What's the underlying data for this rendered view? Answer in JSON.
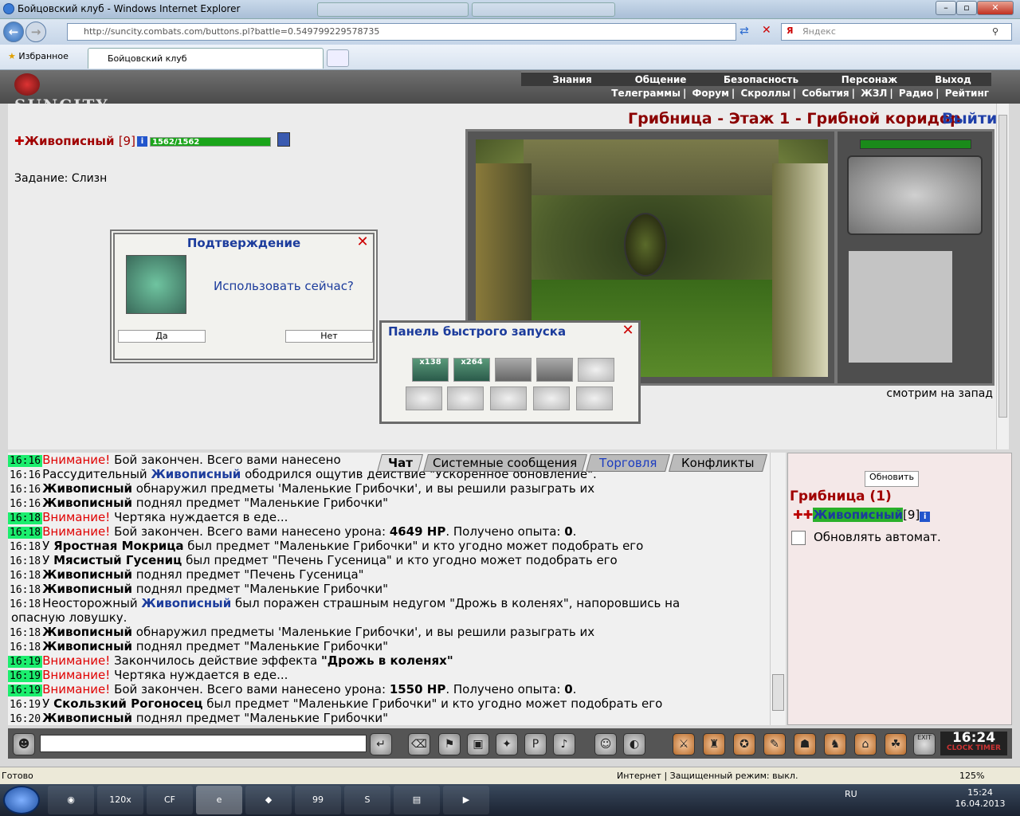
{
  "window": {
    "title": "Бойцовский клуб - Windows Internet Explorer"
  },
  "address": {
    "url": "http://suncity.combats.com/buttons.pl?battle=0.549799229578735",
    "search_placeholder": "Яндекс"
  },
  "favorites": {
    "label": "Избранное",
    "tab_label": "Бойцовский клуб"
  },
  "site": {
    "logo": "SUNCITY",
    "menu_main": [
      "Знания",
      "Общение",
      "Безопасность",
      "Персонаж",
      "Выход"
    ],
    "menu_sub": [
      "Телеграммы",
      "Форум",
      "Скроллы",
      "События",
      "ЖЗЛ",
      "Радио",
      "Рейтинг"
    ]
  },
  "player": {
    "name": "Живописный",
    "level": "[9]",
    "hp": "1562/1562",
    "info_icon": "i"
  },
  "task": "Задание: Слизн",
  "location": {
    "title": "Грибница - Этаж 1 - Грибной коридор",
    "exit": "Выйти",
    "direction": "смотрим на запад"
  },
  "confirm": {
    "title": "Подтверждение",
    "question": "Использовать сейчас?",
    "yes": "Да",
    "no": "Нет"
  },
  "quick_panel": {
    "title": "Панель быстрого запуска",
    "slot1": "x138",
    "slot2": "x264"
  },
  "chat_tabs": [
    "Чат",
    "Системные сообщения",
    "Торговля",
    "Конфликты"
  ],
  "chat": [
    {
      "time": "16:16",
      "g": true,
      "parts": [
        {
          "c": "warn",
          "t": "Внимание!"
        },
        {
          "c": "",
          "t": " Бой закончен. Всего вами нанесено"
        }
      ]
    },
    {
      "time": "16:16",
      "g": false,
      "parts": [
        {
          "c": "",
          "t": "Рассудительный "
        },
        {
          "c": "nmb",
          "t": "Живописный"
        },
        {
          "c": "",
          "t": " ободрился ощутив действие \"Ускоренное обновление\"."
        }
      ]
    },
    {
      "time": "16:16",
      "g": false,
      "parts": [
        {
          "c": "nm",
          "t": "Живописный"
        },
        {
          "c": "",
          "t": " обнаружил предметы 'Маленькие Грибочки', и вы решили разыграть их"
        }
      ]
    },
    {
      "time": "16:16",
      "g": false,
      "parts": [
        {
          "c": "nm",
          "t": "Живописный"
        },
        {
          "c": "",
          "t": " поднял предмет \"Маленькие Грибочки\""
        }
      ]
    },
    {
      "time": "16:18",
      "g": true,
      "parts": [
        {
          "c": "warn",
          "t": "Внимание!"
        },
        {
          "c": "",
          "t": " Чертяка нуждается в еде..."
        }
      ]
    },
    {
      "time": "16:18",
      "g": true,
      "parts": [
        {
          "c": "warn",
          "t": "Внимание!"
        },
        {
          "c": "",
          "t": " Бой закончен. Всего вами нанесено урона: "
        },
        {
          "c": "nm",
          "t": "4649 HP"
        },
        {
          "c": "",
          "t": ". Получено опыта: "
        },
        {
          "c": "nm",
          "t": "0"
        },
        {
          "c": "",
          "t": "."
        }
      ]
    },
    {
      "time": "16:18",
      "g": false,
      "parts": [
        {
          "c": "",
          "t": "У "
        },
        {
          "c": "nm",
          "t": "Яростная Мокрица"
        },
        {
          "c": "",
          "t": " был предмет \"Маленькие Грибочки\" и кто угодно может подобрать его"
        }
      ]
    },
    {
      "time": "16:18",
      "g": false,
      "parts": [
        {
          "c": "",
          "t": "У "
        },
        {
          "c": "nm",
          "t": "Мясистый Гусениц"
        },
        {
          "c": "",
          "t": " был предмет \"Печень Гусеница\" и кто угодно может подобрать его"
        }
      ]
    },
    {
      "time": "16:18",
      "g": false,
      "parts": [
        {
          "c": "nm",
          "t": "Живописный"
        },
        {
          "c": "",
          "t": " поднял предмет \"Печень Гусеница\""
        }
      ]
    },
    {
      "time": "16:18",
      "g": false,
      "parts": [
        {
          "c": "nm",
          "t": "Живописный"
        },
        {
          "c": "",
          "t": " поднял предмет \"Маленькие Грибочки\""
        }
      ]
    },
    {
      "time": "16:18",
      "g": false,
      "parts": [
        {
          "c": "",
          "t": "Неосторожный "
        },
        {
          "c": "nmb",
          "t": "Живописный"
        },
        {
          "c": "",
          "t": " был поражен страшным недугом \"Дрожь в коленях\", напоровшись на"
        }
      ]
    },
    {
      "time": "",
      "g": false,
      "parts": [
        {
          "c": "",
          "t": "опасную ловушку."
        }
      ]
    },
    {
      "time": "16:18",
      "g": false,
      "parts": [
        {
          "c": "nm",
          "t": "Живописный"
        },
        {
          "c": "",
          "t": " обнаружил предметы 'Маленькие Грибочки', и вы решили разыграть их"
        }
      ]
    },
    {
      "time": "16:18",
      "g": false,
      "parts": [
        {
          "c": "nm",
          "t": "Живописный"
        },
        {
          "c": "",
          "t": " поднял предмет \"Маленькие Грибочки\""
        }
      ]
    },
    {
      "time": "16:19",
      "g": true,
      "parts": [
        {
          "c": "warn",
          "t": "Внимание!"
        },
        {
          "c": "",
          "t": " Закончилось действие эффекта "
        },
        {
          "c": "nm",
          "t": "\"Дрожь в коленях\""
        }
      ]
    },
    {
      "time": "16:19",
      "g": true,
      "parts": [
        {
          "c": "warn",
          "t": "Внимание!"
        },
        {
          "c": "",
          "t": " Чертяка нуждается в еде..."
        }
      ]
    },
    {
      "time": "16:19",
      "g": true,
      "parts": [
        {
          "c": "warn",
          "t": "Внимание!"
        },
        {
          "c": "",
          "t": " Бой закончен. Всего вами нанесено урона: "
        },
        {
          "c": "nm",
          "t": "1550 HP"
        },
        {
          "c": "",
          "t": ". Получено опыта: "
        },
        {
          "c": "nm",
          "t": "0"
        },
        {
          "c": "",
          "t": "."
        }
      ]
    },
    {
      "time": "16:19",
      "g": false,
      "parts": [
        {
          "c": "",
          "t": "У "
        },
        {
          "c": "nm",
          "t": "Скользкий Рогоносец"
        },
        {
          "c": "",
          "t": " был предмет \"Маленькие Грибочки\" и кто угодно может подобрать его"
        }
      ]
    },
    {
      "time": "16:20",
      "g": false,
      "parts": [
        {
          "c": "nm",
          "t": "Живописный"
        },
        {
          "c": "",
          "t": " поднял предмет \"Маленькие Грибочки\""
        }
      ]
    }
  ],
  "side": {
    "refresh": "Обновить",
    "location": "Грибница (1)",
    "who": "Живописный",
    "who_level": "[9]",
    "auto": "Обновлять автомат."
  },
  "clock": {
    "time": "16:24",
    "label1": "CLOCK",
    "label2": "TIMER",
    "exit": "EXIT"
  },
  "status": {
    "left": "Готово",
    "middle": "Интернет | Защищенный режим: выкл.",
    "zoom": "125%"
  },
  "taskbar": {
    "lang": "RU",
    "time": "15:24",
    "date": "16.04.2013",
    "app1": "120x",
    "app2": "CF",
    "app3": "99"
  }
}
